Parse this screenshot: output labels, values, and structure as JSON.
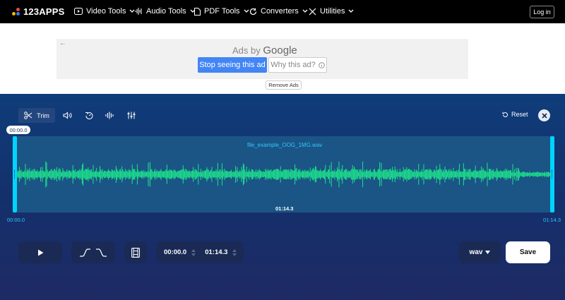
{
  "nav": {
    "logo": "123APPS",
    "items": [
      {
        "label": "Video Tools",
        "icon": "play-square-icon"
      },
      {
        "label": "Audio Tools",
        "icon": "waveform-icon"
      },
      {
        "label": "PDF Tools",
        "icon": "document-icon"
      },
      {
        "label": "Converters",
        "icon": "refresh-icon"
      },
      {
        "label": "Utilities",
        "icon": "tools-icon"
      }
    ],
    "login": "Log in"
  },
  "ad": {
    "ads_by": "Ads by",
    "google": "Google",
    "stop": "Stop seeing this ad",
    "why": "Why this ad?",
    "remove": "Remove Ads"
  },
  "editor": {
    "tools": [
      {
        "label": "Trim",
        "icon": "scissors-icon",
        "active": true
      },
      {
        "label": "",
        "icon": "volume-icon"
      },
      {
        "label": "",
        "icon": "speed-icon"
      },
      {
        "label": "",
        "icon": "equalizer-icon"
      },
      {
        "label": "",
        "icon": "sliders-icon"
      }
    ],
    "reset": "Reset",
    "time_badge": "00:00.0",
    "filename": "file_example_OOG_1MG.wav",
    "duration": "01:14.3",
    "start_label": "00:00.0",
    "end_label": "01:14.3",
    "start_time": "00:00.0",
    "end_time": "01:14.3",
    "format": "wav",
    "save": "Save"
  },
  "colors": {
    "accent": "#00d4ff",
    "wave": "#1de28c",
    "button_blue": "#4285f4"
  }
}
